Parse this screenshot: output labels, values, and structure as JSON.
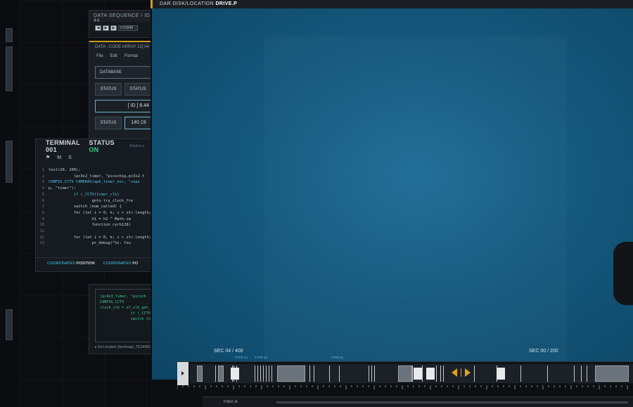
{
  "sequence_window": {
    "title": "DATA SEQUENCE / ID 44",
    "field_value": "# 02848",
    "buttons": [
      "◀",
      "▶",
      "▶"
    ]
  },
  "code_array_window": {
    "title": "DATA : CODE ARRAY 22] 04",
    "menu": [
      "File",
      "Edit",
      "Format"
    ],
    "database_label": "DATABASE",
    "status_a": "STATUS",
    "status_b": "STATUS",
    "id_value": "[ ID ] 8.44",
    "status_c": "STATUS",
    "value": "140.19"
  },
  "terminal": {
    "title": "TERMINAL 001",
    "status_label": "STATUS",
    "status_value": "ON",
    "path": "./Users.s",
    "tools": [
      "M",
      "S"
    ],
    "lines": [
      {
        "n": "1",
        "t": "test(20, 200);",
        "c": ""
      },
      {
        "n": "2",
        "t": "           (pc3x2_timer, \"picochip,pc3x2-t",
        "c": ""
      },
      {
        "n": "3",
        "t": "CONFIG_CCTV CAMERAS(apb_timer_osc, \"snps",
        "c": "cyan"
      },
      {
        "n": "4",
        "t": "p, \"timer\");",
        "c": ""
      },
      {
        "n": "5",
        "t": "           if (_CCTV(timer_clk)",
        "c": "cyan"
      },
      {
        "n": "6",
        "t": "                   goto try_clock_fre",
        "c": ""
      },
      {
        "n": "7",
        "t": "           switch (num_called) {",
        "c": ""
      },
      {
        "n": "8",
        "t": "           for (let i = 0, k; i < str.length; i+",
        "c": ""
      },
      {
        "n": "9",
        "t": "                   h1 = h2 ^ Math.im",
        "c": ""
      },
      {
        "n": "10",
        "t": "                   function cyrb128(",
        "c": ""
      },
      {
        "n": "11",
        "t": "",
        "c": ""
      },
      {
        "n": "12",
        "t": "           for (let i = 0, k; i < str.length; i+",
        "c": ""
      },
      {
        "n": "13",
        "t": "                   pr_debug(\"%s: fou",
        "c": ""
      }
    ],
    "footer": [
      {
        "label": "COORDINATES",
        "value": "POSITION"
      },
      {
        "label": "COORDINATES",
        "value": "PO"
      }
    ]
  },
  "code_box_2": {
    "lines": [
      {
        "t": "(pc4x3_timer, \"picoch",
        "c": "g"
      },
      {
        "t": "CONFIG_CCTV",
        "c": "g"
      },
      {
        "t": "clock_clk = of_clk_get_",
        "c": "g"
      },
      {
        "t": "              if (_CCTV",
        "c": "g"
      },
      {
        "t": "",
        "c": "w"
      },
      {
        "t": "              switch (n",
        "c": "g"
      }
    ],
    "path": "▸ Ue:Location /fan/image_TES4982"
  },
  "viewport": {
    "title_prefix": "DAR.DISK/LOCATION",
    "title_value": "DRIVE.P",
    "sec_left": "SEC 04 / 400",
    "sec_right": "SEC 00 / 200",
    "mini_labels": [
      "TYPE 04",
      "TYPE 04",
      "TYPE 04"
    ]
  },
  "bottom_bar": {
    "label": "FSEC A"
  },
  "colors": {
    "accent": "#d29e1f",
    "screen_blue": "#14587d",
    "status_green": "#3bd08a"
  }
}
